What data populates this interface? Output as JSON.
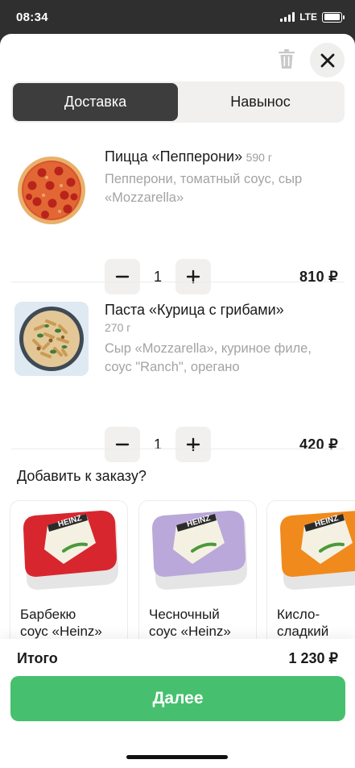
{
  "status_bar": {
    "time": "08:34",
    "network": "LTE",
    "battery_level": 0.95
  },
  "header": {
    "trash_icon": "trash-icon",
    "close_icon": "close-icon"
  },
  "tabs": [
    {
      "label": "Доставка",
      "active": true
    },
    {
      "label": "Навынос",
      "active": false
    }
  ],
  "cart": [
    {
      "name": "Пицца «Пепперони»",
      "weight": "590 г",
      "description": "Пепперони, томатный соус, сыр «Mozzarella»",
      "quantity": "1",
      "price": "810 ₽",
      "minus_icon": "minus-icon",
      "plus_icon": "plus-icon"
    },
    {
      "name": "Паста «Курица с грибами»",
      "weight": "270 г",
      "description": "Сыр «Mozzarella», куриное филе, соус \"Ranch\", орегано",
      "quantity": "1",
      "price": "420 ₽",
      "minus_icon": "minus-icon",
      "plus_icon": "plus-icon"
    }
  ],
  "upsell": {
    "title": "Добавить к заказу?",
    "items": [
      {
        "name": "Барбекю\nсоус «Heinz»",
        "lid_color": "#d8262f",
        "logo": "HEINZ"
      },
      {
        "name": "Чесночный\nсоус «Heinz»",
        "lid_color": "#b9a8d9",
        "logo": "HEINZ"
      },
      {
        "name": "Кисло-\nсладкий «Heinz»",
        "lid_color": "#f08a1c",
        "logo": "HEINZ"
      }
    ]
  },
  "footer": {
    "total_label": "Итого",
    "total_value": "1 230 ₽",
    "next_label": "Далее"
  },
  "colors": {
    "accent": "#46c06e",
    "active_tab": "#3d3d3d",
    "chip_bg": "#f1f0ee"
  }
}
